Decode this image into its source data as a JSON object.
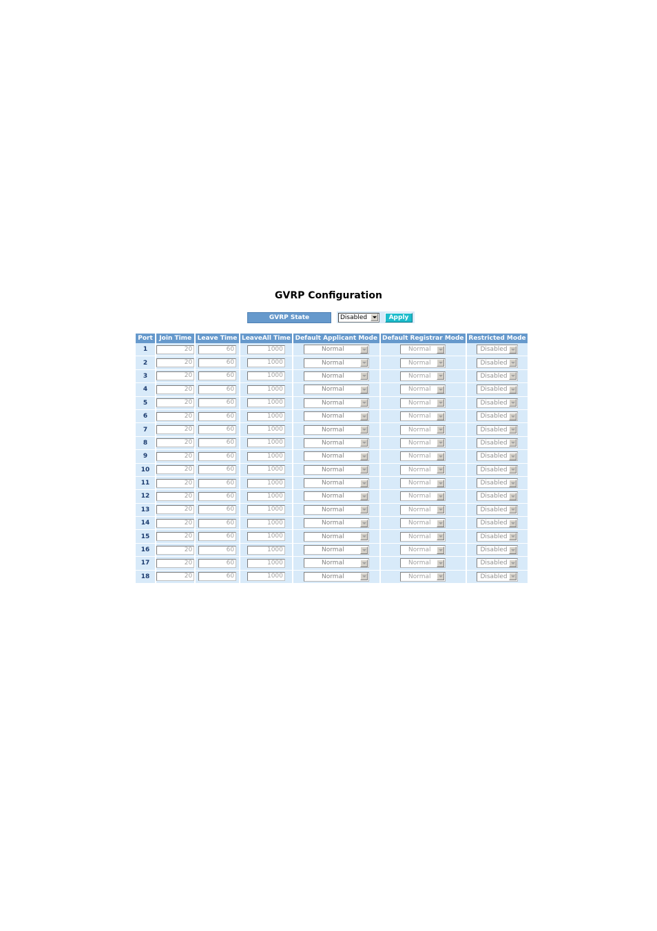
{
  "page": {
    "title": "GVRP Configuration"
  },
  "gvrp_state": {
    "label": "GVRP State",
    "value": "Disabled",
    "apply_label": "Apply"
  },
  "table": {
    "headers": [
      "Port",
      "Join Time",
      "Leave Time",
      "LeaveAll Time",
      "Default Applicant Mode",
      "Default Registrar Mode",
      "Restricted Mode"
    ],
    "rows": [
      {
        "port": "1",
        "join": "20",
        "leave": "60",
        "leaveall": "1000",
        "applicant": "Normal",
        "registrar": "Normal",
        "restricted": "Disabled"
      },
      {
        "port": "2",
        "join": "20",
        "leave": "60",
        "leaveall": "1000",
        "applicant": "Normal",
        "registrar": "Normal",
        "restricted": "Disabled"
      },
      {
        "port": "3",
        "join": "20",
        "leave": "60",
        "leaveall": "1000",
        "applicant": "Normal",
        "registrar": "Normal",
        "restricted": "Disabled"
      },
      {
        "port": "4",
        "join": "20",
        "leave": "60",
        "leaveall": "1000",
        "applicant": "Normal",
        "registrar": "Normal",
        "restricted": "Disabled"
      },
      {
        "port": "5",
        "join": "20",
        "leave": "60",
        "leaveall": "1000",
        "applicant": "Normal",
        "registrar": "Normal",
        "restricted": "Disabled"
      },
      {
        "port": "6",
        "join": "20",
        "leave": "60",
        "leaveall": "1000",
        "applicant": "Normal",
        "registrar": "Normal",
        "restricted": "Disabled"
      },
      {
        "port": "7",
        "join": "20",
        "leave": "60",
        "leaveall": "1000",
        "applicant": "Normal",
        "registrar": "Normal",
        "restricted": "Disabled"
      },
      {
        "port": "8",
        "join": "20",
        "leave": "60",
        "leaveall": "1000",
        "applicant": "Normal",
        "registrar": "Normal",
        "restricted": "Disabled"
      },
      {
        "port": "9",
        "join": "20",
        "leave": "60",
        "leaveall": "1000",
        "applicant": "Normal",
        "registrar": "Normal",
        "restricted": "Disabled"
      },
      {
        "port": "10",
        "join": "20",
        "leave": "60",
        "leaveall": "1000",
        "applicant": "Normal",
        "registrar": "Normal",
        "restricted": "Disabled"
      },
      {
        "port": "11",
        "join": "20",
        "leave": "60",
        "leaveall": "1000",
        "applicant": "Normal",
        "registrar": "Normal",
        "restricted": "Disabled"
      },
      {
        "port": "12",
        "join": "20",
        "leave": "60",
        "leaveall": "1000",
        "applicant": "Normal",
        "registrar": "Normal",
        "restricted": "Disabled"
      },
      {
        "port": "13",
        "join": "20",
        "leave": "60",
        "leaveall": "1000",
        "applicant": "Normal",
        "registrar": "Normal",
        "restricted": "Disabled"
      },
      {
        "port": "14",
        "join": "20",
        "leave": "60",
        "leaveall": "1000",
        "applicant": "Normal",
        "registrar": "Normal",
        "restricted": "Disabled"
      },
      {
        "port": "15",
        "join": "20",
        "leave": "60",
        "leaveall": "1000",
        "applicant": "Normal",
        "registrar": "Normal",
        "restricted": "Disabled"
      },
      {
        "port": "16",
        "join": "20",
        "leave": "60",
        "leaveall": "1000",
        "applicant": "Normal",
        "registrar": "Normal",
        "restricted": "Disabled"
      },
      {
        "port": "17",
        "join": "20",
        "leave": "60",
        "leaveall": "1000",
        "applicant": "Normal",
        "registrar": "Normal",
        "restricted": "Disabled"
      },
      {
        "port": "18",
        "join": "20",
        "leave": "60",
        "leaveall": "1000",
        "applicant": "Normal",
        "registrar": "Normal",
        "restricted": "Disabled"
      }
    ]
  },
  "colors": {
    "header_bg": "#6699cc",
    "row_bg": "#d8eaf9",
    "apply_bg": "#1cbccc"
  }
}
